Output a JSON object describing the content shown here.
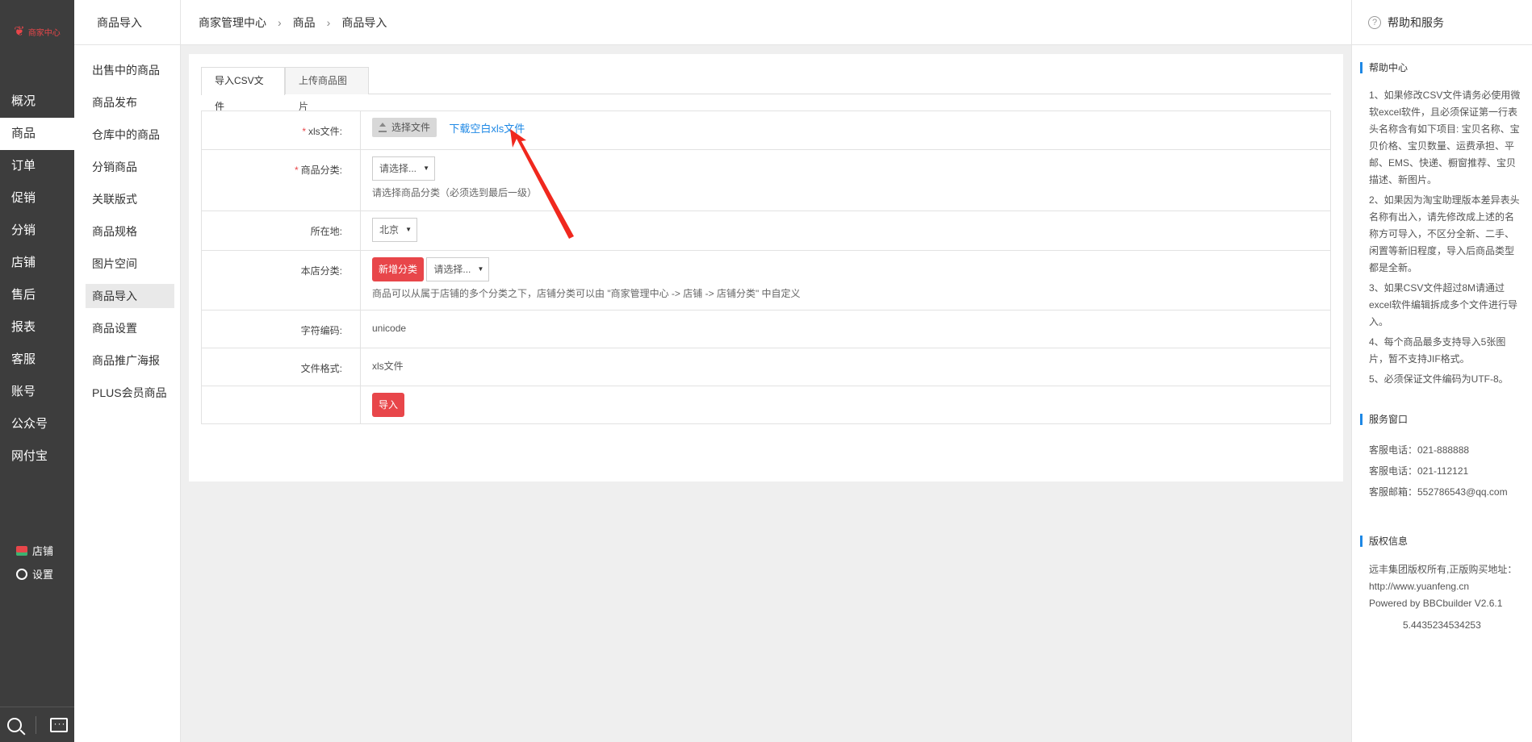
{
  "logo": {
    "text": "商家中心"
  },
  "main_nav": [
    "概况",
    "商品",
    "订单",
    "促销",
    "分销",
    "店铺",
    "售后",
    "报表",
    "客服",
    "账号",
    "公众号",
    "网付宝"
  ],
  "main_nav_active": "商品",
  "nav_bottom": {
    "shop": "店铺",
    "settings": "设置"
  },
  "sub_nav": {
    "title": "商品导入",
    "items": [
      "出售中的商品",
      "商品发布",
      "仓库中的商品",
      "分销商品",
      "关联版式",
      "商品规格",
      "图片空间",
      "商品导入",
      "商品设置",
      "商品推广海报",
      "PLUS会员商品"
    ],
    "active": "商品导入"
  },
  "breadcrumb": [
    "商家管理中心",
    "商品",
    "商品导入"
  ],
  "tabs": [
    "导入CSV文件",
    "上传商品图片"
  ],
  "form": {
    "file_label": "xls文件:",
    "file_button": "选择文件",
    "download_link": "下载空白xls文件",
    "category_label": "商品分类:",
    "category_select": "请选择...",
    "category_hint": "请选择商品分类（必须选到最后一级）",
    "location_label": "所在地:",
    "location_select": "北京",
    "store_cat_label": "本店分类:",
    "store_cat_button": "新增分类",
    "store_cat_select": "请选择...",
    "store_cat_hint": "商品可以从属于店铺的多个分类之下，店铺分类可以由 \"商家管理中心 -> 店铺 -> 店铺分类\" 中自定义",
    "encoding_label": "字符编码:",
    "encoding_value": "unicode",
    "format_label": "文件格式:",
    "format_value": "xls文件",
    "import_button": "导入"
  },
  "help": {
    "title": "帮助和服务",
    "help_center_title": "帮助中心",
    "help_items": [
      "1、如果修改CSV文件请务必使用微软excel软件，且必须保证第一行表头名称含有如下项目: 宝贝名称、宝贝价格、宝贝数量、运费承担、平邮、EMS、快递、橱窗推荐、宝贝描述、新图片。",
      "2、如果因为淘宝助理版本差异表头名称有出入，请先修改成上述的名称方可导入，不区分全新、二手、闲置等新旧程度，导入后商品类型都是全新。",
      "3、如果CSV文件超过8M请通过excel软件编辑拆成多个文件进行导入。",
      "4、每个商品最多支持导入5张图片，暂不支持JIF格式。",
      "5、必须保证文件编码为UTF-8。"
    ],
    "service_title": "服务窗口",
    "service_items": [
      "客服电话：021-888888",
      "客服电话：021-112121",
      "客服邮箱：552786543@qq.com"
    ],
    "copyright_title": "版权信息",
    "copyright_text": "远丰集团版权所有,正版购买地址：http://www.yuanfeng.cn",
    "powered": "Powered by BBCbuilder V2.6.1",
    "version_num": "5.4435234534253"
  },
  "colors": {
    "accent_red": "#e8464a",
    "link_blue": "#1e88e5",
    "sidebar_dark": "#3d3d3d"
  }
}
